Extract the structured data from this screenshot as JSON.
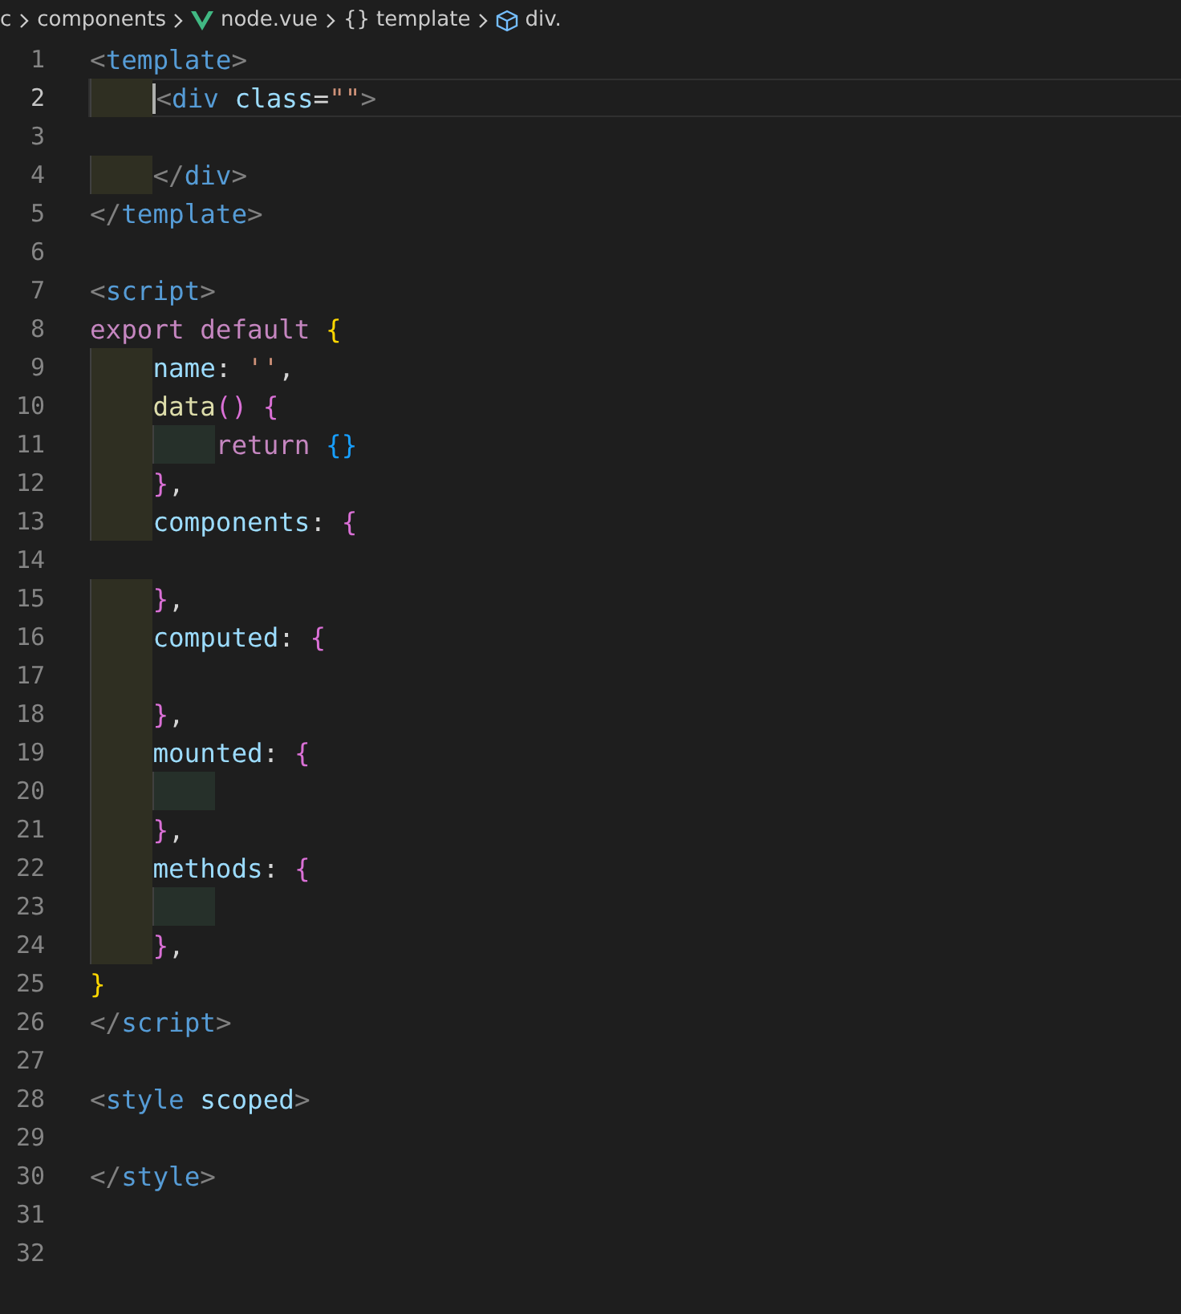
{
  "breadcrumb": [
    {
      "kind": "folder",
      "label": "c"
    },
    {
      "kind": "folder",
      "label": "components"
    },
    {
      "kind": "vue",
      "label": "node.vue"
    },
    {
      "kind": "symbol",
      "symbol": "{}",
      "label": "template"
    },
    {
      "kind": "element",
      "label": "div."
    }
  ],
  "lines": [
    {
      "number": "1",
      "selected": false,
      "tokens": [
        {
          "kind": "punct",
          "text": "<"
        },
        {
          "kind": "tag",
          "text": "template"
        },
        {
          "kind": "punct",
          "text": ">"
        }
      ]
    },
    {
      "number": "2",
      "selected": true,
      "tokens": [
        {
          "kind": "indent"
        },
        {
          "kind": "punct",
          "text": "<"
        },
        {
          "kind": "tag",
          "text": "div"
        },
        {
          "kind": "attr",
          "text": " class"
        },
        {
          "kind": "plain",
          "text": "="
        },
        {
          "kind": "string",
          "text": "\"\""
        },
        {
          "kind": "punct",
          "text": ">"
        }
      ]
    },
    {
      "number": "3",
      "selected": false
    },
    {
      "number": "4",
      "selected": false,
      "tokens": [
        {
          "kind": "indent"
        },
        {
          "kind": "punct",
          "text": "</"
        },
        {
          "kind": "tag",
          "text": "div"
        },
        {
          "kind": "punct",
          "text": ">"
        }
      ]
    },
    {
      "number": "5",
      "selected": false,
      "tokens": [
        {
          "kind": "punct",
          "text": "</"
        },
        {
          "kind": "tag",
          "text": "template"
        },
        {
          "kind": "punct",
          "text": ">"
        }
      ]
    },
    {
      "number": "6",
      "selected": false
    },
    {
      "number": "7",
      "selected": false,
      "tokens": [
        {
          "kind": "punct",
          "text": "<"
        },
        {
          "kind": "tag",
          "text": "script"
        },
        {
          "kind": "punct",
          "text": ">"
        }
      ]
    },
    {
      "number": "8",
      "selected": false,
      "tokens": [
        {
          "kind": "keyword",
          "text": "export default "
        },
        {
          "kind": "brace1",
          "text": "{"
        }
      ]
    },
    {
      "number": "9",
      "selected": false,
      "tokens": [
        {
          "kind": "indent"
        },
        {
          "kind": "prop",
          "text": "name"
        },
        {
          "kind": "plain",
          "text": ": "
        },
        {
          "kind": "string",
          "text": "''"
        },
        {
          "kind": "plain",
          "text": ","
        }
      ]
    },
    {
      "number": "10",
      "selected": false,
      "tokens": [
        {
          "kind": "indent"
        },
        {
          "kind": "func",
          "text": "data"
        },
        {
          "kind": "brace2",
          "text": "() {"
        }
      ]
    },
    {
      "number": "11",
      "selected": false,
      "tokens": [
        {
          "kind": "indent"
        },
        {
          "kind": "indent"
        },
        {
          "kind": "keyword",
          "text": "return "
        },
        {
          "kind": "brace3",
          "text": "{}"
        }
      ]
    },
    {
      "number": "12",
      "selected": false,
      "tokens": [
        {
          "kind": "indent"
        },
        {
          "kind": "brace2",
          "text": "}"
        },
        {
          "kind": "plain",
          "text": ","
        }
      ]
    },
    {
      "number": "13",
      "selected": false,
      "tokens": [
        {
          "kind": "indent"
        },
        {
          "kind": "prop",
          "text": "components"
        },
        {
          "kind": "plain",
          "text": ": "
        },
        {
          "kind": "brace2",
          "text": "{"
        }
      ]
    },
    {
      "number": "14",
      "selected": false
    },
    {
      "number": "15",
      "selected": false,
      "tokens": [
        {
          "kind": "indent"
        },
        {
          "kind": "brace2",
          "text": "}"
        },
        {
          "kind": "plain",
          "text": ","
        }
      ]
    },
    {
      "number": "16",
      "selected": false,
      "tokens": [
        {
          "kind": "indent"
        },
        {
          "kind": "prop",
          "text": "computed"
        },
        {
          "kind": "plain",
          "text": ": "
        },
        {
          "kind": "brace2",
          "text": "{"
        }
      ]
    },
    {
      "number": "17",
      "selected": false,
      "tokens": [
        {
          "kind": "indent"
        }
      ]
    },
    {
      "number": "18",
      "selected": false,
      "tokens": [
        {
          "kind": "indent"
        },
        {
          "kind": "brace2",
          "text": "}"
        },
        {
          "kind": "plain",
          "text": ","
        }
      ]
    },
    {
      "number": "19",
      "selected": false,
      "tokens": [
        {
          "kind": "indent"
        },
        {
          "kind": "prop",
          "text": "mounted"
        },
        {
          "kind": "plain",
          "text": ": "
        },
        {
          "kind": "brace2",
          "text": "{"
        }
      ]
    },
    {
      "number": "20",
      "selected": false,
      "tokens": [
        {
          "kind": "indent"
        },
        {
          "kind": "indent"
        }
      ]
    },
    {
      "number": "21",
      "selected": false,
      "tokens": [
        {
          "kind": "indent"
        },
        {
          "kind": "brace2",
          "text": "}"
        },
        {
          "kind": "plain",
          "text": ","
        }
      ]
    },
    {
      "number": "22",
      "selected": false,
      "tokens": [
        {
          "kind": "indent"
        },
        {
          "kind": "prop",
          "text": "methods"
        },
        {
          "kind": "plain",
          "text": ": "
        },
        {
          "kind": "brace2",
          "text": "{"
        }
      ]
    },
    {
      "number": "23",
      "selected": false,
      "tokens": [
        {
          "kind": "indent"
        },
        {
          "kind": "indent"
        }
      ]
    },
    {
      "number": "24",
      "selected": false,
      "tokens": [
        {
          "kind": "indent"
        },
        {
          "kind": "brace2",
          "text": "}"
        },
        {
          "kind": "plain",
          "text": ","
        }
      ]
    },
    {
      "number": "25",
      "selected": false,
      "tokens": [
        {
          "kind": "brace1",
          "text": "}"
        }
      ]
    },
    {
      "number": "26",
      "selected": false,
      "tokens": [
        {
          "kind": "punct",
          "text": "</"
        },
        {
          "kind": "tag",
          "text": "script"
        },
        {
          "kind": "punct",
          "text": ">"
        }
      ]
    },
    {
      "number": "27",
      "selected": false
    },
    {
      "number": "28",
      "selected": false,
      "tokens": [
        {
          "kind": "punct",
          "text": "<"
        },
        {
          "kind": "tag",
          "text": "style"
        },
        {
          "kind": "attr",
          "text": " scoped"
        },
        {
          "kind": "punct",
          "text": ">"
        }
      ]
    },
    {
      "number": "29",
      "selected": false
    },
    {
      "number": "30",
      "selected": false,
      "tokens": [
        {
          "kind": "punct",
          "text": "</"
        },
        {
          "kind": "tag",
          "text": "style"
        },
        {
          "kind": "punct",
          "text": ">"
        }
      ]
    },
    {
      "number": "31",
      "selected": false
    },
    {
      "number": "32",
      "selected": false
    }
  ]
}
